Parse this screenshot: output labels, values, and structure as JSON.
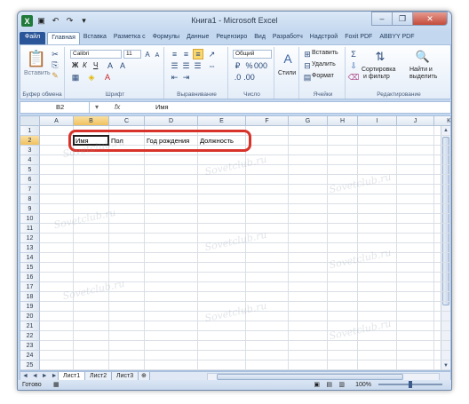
{
  "window": {
    "title": "Книга1 - Microsoft Excel",
    "minimize": "–",
    "restore": "❐",
    "close": "✕"
  },
  "tabs": {
    "file": "Файл",
    "items": [
      "Главная",
      "Вставка",
      "Разметка с",
      "Формулы",
      "Данные",
      "Рецензиро",
      "Вид",
      "Разработч",
      "Надстрой",
      "Foxit PDF",
      "ABBYY PDF"
    ]
  },
  "ribbon": {
    "clipboard": {
      "paste": "Вставить",
      "label": "Буфер обмена"
    },
    "font": {
      "name": "Calibri",
      "size": "11",
      "bold": "Ж",
      "italic": "К",
      "underline": "Ч",
      "label": "Шрифт"
    },
    "alignment": {
      "label": "Выравнивание"
    },
    "number": {
      "format": "Общий",
      "label": "Число"
    },
    "styles": {
      "styles": "Стили"
    },
    "cells": {
      "insert": "Вставить",
      "delete": "Удалить",
      "format": "Формат",
      "label": "Ячейки"
    },
    "editing": {
      "sort": "Сортировка",
      "filter": "и фильтр",
      "find": "Найти и",
      "select": "выделить",
      "label": "Редактирование"
    }
  },
  "formula_bar": {
    "name_box": "B2",
    "fx": "fx",
    "value": "Имя"
  },
  "columns": [
    "A",
    "B",
    "C",
    "D",
    "E",
    "F",
    "G",
    "H",
    "I",
    "J",
    "K"
  ],
  "rows": [
    "1",
    "2",
    "3",
    "4",
    "5",
    "6",
    "7",
    "8",
    "9",
    "10",
    "11",
    "12",
    "13",
    "14",
    "15",
    "16",
    "17",
    "18",
    "19",
    "20",
    "21",
    "22",
    "23",
    "24",
    "25"
  ],
  "cells": {
    "B2": "Имя",
    "C2": "Пол",
    "D2": "Год рождения",
    "E2": "Должность"
  },
  "sheets": {
    "nav": "◄ ◄ ► ►",
    "tabs": [
      "Лист1",
      "Лист2",
      "Лист3"
    ],
    "active": "Лист1"
  },
  "status": {
    "text": "Готово",
    "zoom": "100%",
    "zoom_value": 100
  },
  "watermark": "Sovetclub.ru",
  "colors": {
    "highlight": "#d8332a",
    "file_tab": "#2a5699",
    "selected_header": "#f1c15f"
  }
}
